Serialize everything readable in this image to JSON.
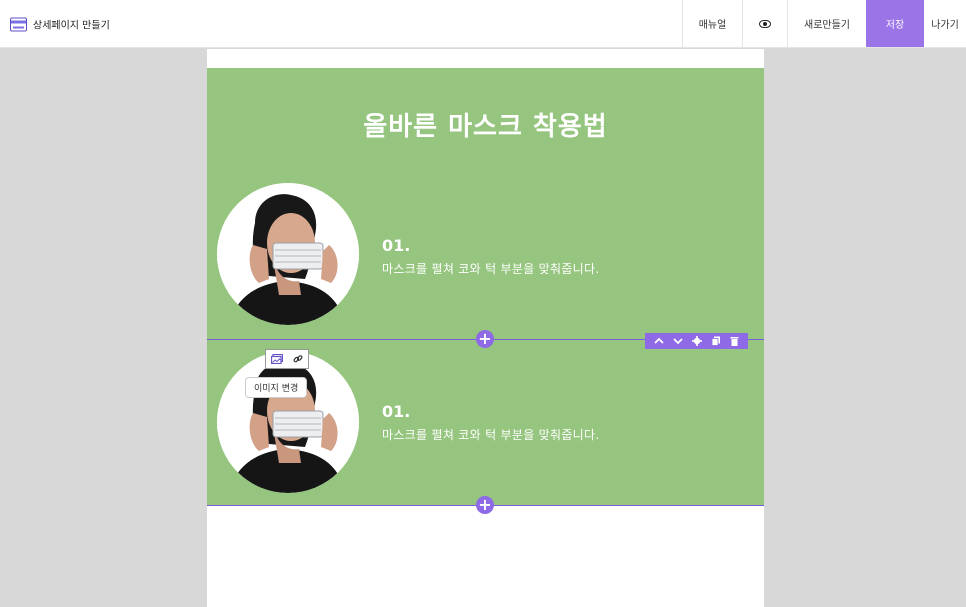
{
  "topbar": {
    "app_title": "상세페이지 만들기",
    "manual_label": "매뉴얼",
    "new_label": "새로만들기",
    "save_label": "저장",
    "exit_label": "나가기"
  },
  "content": {
    "headline": "올바른 마스크 착용법",
    "steps": [
      {
        "number": "01.",
        "text": "마스크를 펼쳐 코와 턱 부분을 맞춰줍니다."
      },
      {
        "number": "01.",
        "text": "마스크를 펼쳐 코와 턱 부분을 맞춰줍니다."
      }
    ]
  },
  "editor": {
    "add_symbol": "+",
    "image_change_tooltip": "이미지 변경"
  },
  "colors": {
    "section_bg": "#95c57e",
    "accent": "#8e6ae6",
    "save_bg": "#9b74e8"
  }
}
